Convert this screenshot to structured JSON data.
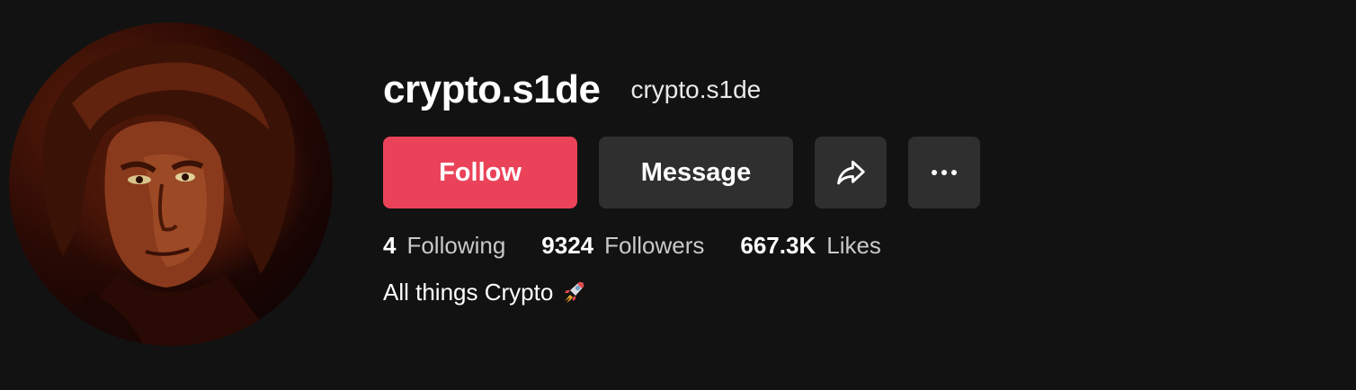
{
  "profile": {
    "username": "crypto.s1de",
    "nickname": "crypto.s1de",
    "bio": "All things Crypto",
    "bio_emoji": "rocket-icon"
  },
  "actions": {
    "follow_label": "Follow",
    "message_label": "Message",
    "share_icon": "share-icon",
    "more_icon": "more-icon"
  },
  "stats": {
    "following_count": "4",
    "following_label": "Following",
    "followers_count": "9324",
    "followers_label": "Followers",
    "likes_count": "667.3K",
    "likes_label": "Likes"
  },
  "colors": {
    "background": "#121212",
    "follow_button": "#ea4359",
    "secondary_button": "#2f2f2f",
    "text_primary": "#ffffff",
    "text_secondary": "#c9c9c9"
  }
}
